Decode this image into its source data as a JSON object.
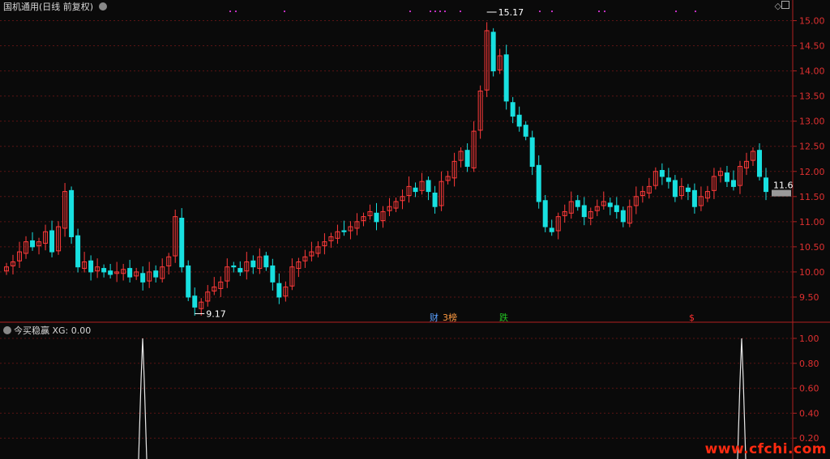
{
  "header": {
    "stock_name": "国机通用",
    "period": "(日线 前复权)"
  },
  "indicator": {
    "name": "今买稳赢",
    "readout": "XG: 0.00"
  },
  "price_axis": {
    "ticks": [
      "15.00",
      "14.50",
      "14.00",
      "13.50",
      "13.00",
      "12.50",
      "12.00",
      "11.50",
      "11.00",
      "10.50",
      "10.00",
      "9.50"
    ],
    "range": [
      9.0,
      15.25
    ],
    "current_price_label": "11.6"
  },
  "indicator_axis": {
    "ticks": [
      "1.00",
      "0.80",
      "0.60",
      "0.40",
      "0.20"
    ]
  },
  "annotations": {
    "high_label": "15.17",
    "low_label": "9.17",
    "event_tags": [
      {
        "text": "财",
        "color": "#5aa0ff"
      },
      {
        "text": "3榜",
        "color": "#ff9a40"
      },
      {
        "text": "跌",
        "color": "#22c022"
      },
      {
        "text": "$",
        "color": "#ff3030"
      }
    ]
  },
  "watermark": "www.cfchi.com",
  "colors": {
    "up": "#ff3a3a",
    "down": "#18e0e0",
    "grid": "#5a1414",
    "axis": "#b02020",
    "marker": "#c030c0"
  },
  "chart_data": {
    "type": "candlestick",
    "ylim": [
      9.0,
      15.25
    ],
    "high": 15.17,
    "low": 9.17,
    "last_close": 11.6,
    "close_series": [
      10.1,
      10.2,
      10.4,
      10.6,
      10.5,
      10.6,
      10.8,
      10.4,
      10.9,
      11.6,
      10.7,
      10.1,
      10.2,
      10.0,
      10.1,
      10.0,
      9.95,
      10.0,
      10.05,
      9.9,
      10.0,
      9.8,
      10.0,
      9.9,
      10.1,
      10.3,
      11.1,
      10.1,
      9.5,
      9.3,
      9.4,
      9.6,
      9.7,
      9.8,
      10.1,
      10.1,
      10.0,
      10.2,
      10.1,
      10.3,
      10.1,
      9.8,
      9.5,
      9.7,
      10.1,
      10.2,
      10.3,
      10.4,
      10.5,
      10.6,
      10.7,
      10.8,
      10.8,
      10.9,
      11.0,
      11.1,
      11.2,
      11.0,
      11.2,
      11.3,
      11.4,
      11.5,
      11.7,
      11.6,
      11.8,
      11.6,
      11.3,
      11.8,
      11.9,
      12.2,
      12.4,
      12.1,
      12.8,
      13.6,
      14.8,
      14.0,
      14.3,
      13.4,
      13.1,
      12.9,
      12.7,
      12.1,
      11.4,
      10.9,
      10.8,
      11.1,
      11.2,
      11.4,
      11.3,
      11.1,
      11.2,
      11.3,
      11.4,
      11.3,
      11.2,
      11.0,
      11.3,
      11.5,
      11.6,
      11.7,
      12.0,
      11.9,
      11.8,
      11.5,
      11.7,
      11.6,
      11.3,
      11.5,
      11.6,
      11.9,
      12.0,
      11.8,
      11.7,
      12.1,
      12.2,
      12.4,
      11.9,
      11.6
    ]
  }
}
